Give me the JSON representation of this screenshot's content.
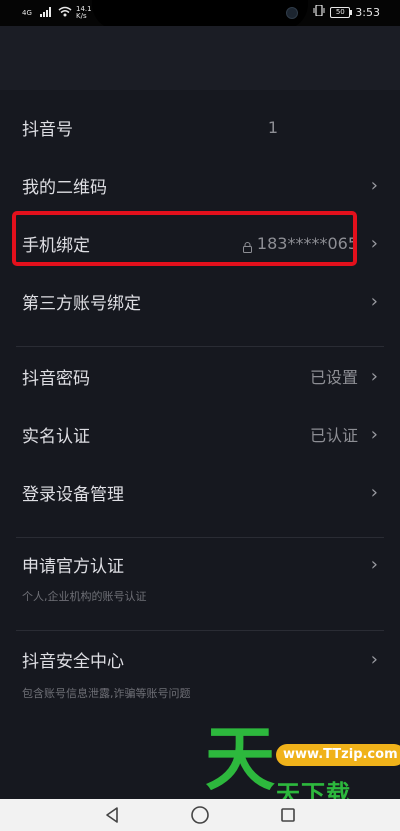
{
  "status_bar": {
    "network_top": "4G",
    "net_speed": "14.1",
    "net_unit": "K/s",
    "battery": "50",
    "time": "3:53"
  },
  "account": {
    "items": [
      {
        "label": "抖音号",
        "value": "1"
      },
      {
        "label": "我的二维码",
        "value": ""
      },
      {
        "label": "手机绑定",
        "value": "183*****065"
      },
      {
        "label": "第三方账号绑定",
        "value": ""
      }
    ]
  },
  "security": {
    "items": [
      {
        "label": "抖音密码",
        "value": "已设置"
      },
      {
        "label": "实名认证",
        "value": "已认证"
      },
      {
        "label": "登录设备管理",
        "value": ""
      }
    ]
  },
  "official": {
    "label": "申请官方认证",
    "sub": "个人,企业机构的账号认证"
  },
  "safety": {
    "label": "抖音安全中心",
    "sub": "包含账号信息泄露,诈骗等账号问题"
  },
  "watermark": {
    "big": "天",
    "url": "www.TTzip.com",
    "text": "天下载"
  },
  "colors": {
    "background": "#16181f",
    "highlight": "#e3101c",
    "watermark_green": "#2db83d",
    "watermark_orange": "#f0b21a"
  },
  "icons": [
    "chevron-right-icon",
    "lock-icon",
    "back-icon",
    "home-icon",
    "recents-icon",
    "wifi-icon",
    "vibrate-icon",
    "battery-icon"
  ]
}
